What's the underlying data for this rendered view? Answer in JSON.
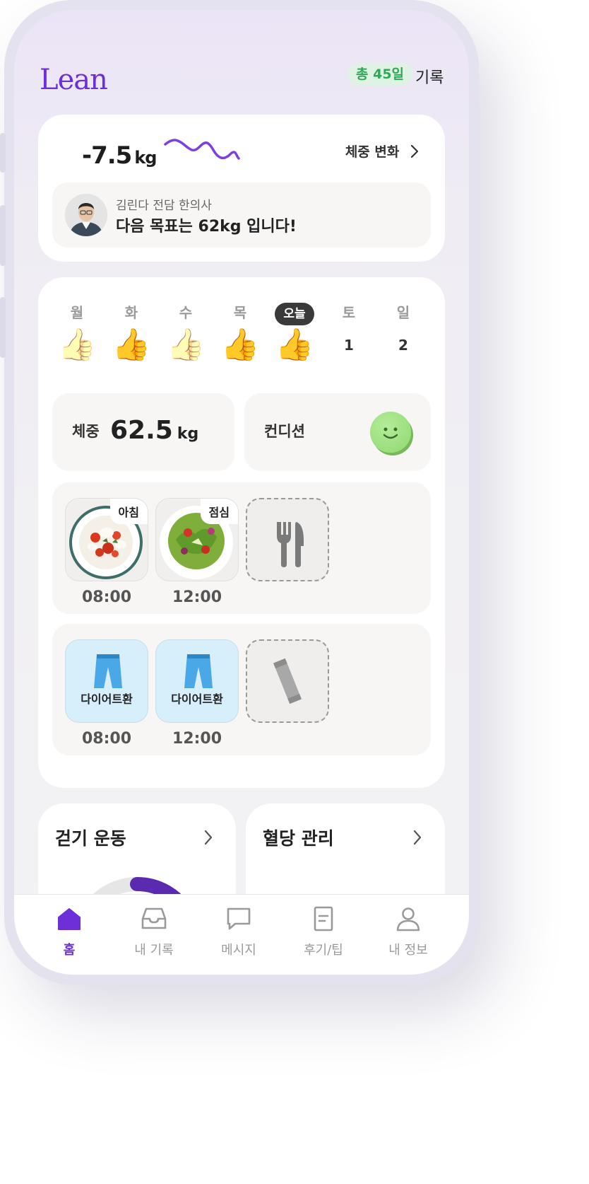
{
  "header": {
    "logo": "Lean",
    "total_badge": "총 45일",
    "record_link": "기록"
  },
  "weight_card": {
    "change_value": "-7.5",
    "change_unit": "kg",
    "change_link": "체중 변화",
    "coach_name": "김린다 전담 한의사",
    "coach_message": "다음 목표는 62kg 입니다!"
  },
  "week": {
    "days": [
      {
        "label": "월",
        "state": "done-pale"
      },
      {
        "label": "화",
        "state": "done"
      },
      {
        "label": "수",
        "state": "done-pale"
      },
      {
        "label": "목",
        "state": "done"
      },
      {
        "label": "오늘",
        "state": "today"
      },
      {
        "label": "토",
        "state": "future",
        "num": "1"
      },
      {
        "label": "일",
        "state": "future",
        "num": "2"
      }
    ]
  },
  "stats": {
    "weight_label": "체중",
    "weight_value": "62.5",
    "weight_unit": "kg",
    "condition_label": "컨디션",
    "condition_icon": "smile-face-icon"
  },
  "meals": [
    {
      "tag": "아침",
      "time": "08:00"
    },
    {
      "tag": "점심",
      "time": "12:00"
    },
    {
      "tag": "",
      "time": "",
      "icon": "fork-knife-icon"
    }
  ],
  "pills": [
    {
      "label": "다이어트환",
      "time": "08:00"
    },
    {
      "label": "다이어트환",
      "time": "12:00"
    },
    {
      "label": "",
      "time": "",
      "icon": "stick-pouch-icon"
    }
  ],
  "walking": {
    "title": "걷기 운동"
  },
  "blood_sugar": {
    "title": "혈당 관리"
  },
  "tabs": [
    {
      "label": "홈",
      "icon": "home-icon",
      "active": true
    },
    {
      "label": "내 기록",
      "icon": "inbox-icon"
    },
    {
      "label": "메시지",
      "icon": "message-icon"
    },
    {
      "label": "후기/팁",
      "icon": "document-icon"
    },
    {
      "label": "내 정보",
      "icon": "person-icon"
    }
  ],
  "colors": {
    "brand": "#6c2fd8",
    "badge_green": "#2fa955",
    "sparkline": "#7b3fe4",
    "donut": "#5a2bb0"
  }
}
